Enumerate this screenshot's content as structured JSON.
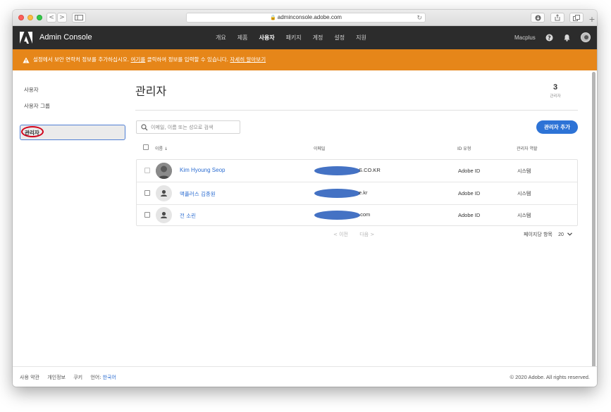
{
  "browser": {
    "url": "adminconsole.adobe.com",
    "back_label": "<",
    "forward_label": ">",
    "new_tab_label": "+"
  },
  "header": {
    "title": "Admin Console",
    "nav": [
      "개요",
      "제품",
      "사용자",
      "패키지",
      "계정",
      "설정",
      "지원"
    ],
    "active_nav": "사용자",
    "org_name": "Macplus",
    "icons": [
      "help-icon",
      "bell-icon",
      "avatar"
    ]
  },
  "banner": {
    "text_before": "설정에서 보안 연락처 정보를 추가하십시오. ",
    "link_here": "여기를",
    "text_after": " 클릭하여 정보를 입력할 수 있습니다. ",
    "learn_more": "자세히 알아보기",
    "color": "#e68619"
  },
  "sidebar": {
    "items": [
      "사용자",
      "사용자 그룹",
      "관리자"
    ],
    "selected": "관리자"
  },
  "main": {
    "title": "관리자",
    "count": "3",
    "count_label": "관리자",
    "search_placeholder": "이메일, 이름 또는 성으로 검색",
    "add_button": "관리자 추가",
    "accent": "#2d73d6"
  },
  "table": {
    "headers": {
      "name": "이름",
      "sort_icon": "↓",
      "email": "이메일",
      "id_type": "ID 유형",
      "role": "관리자 역할"
    },
    "rows": [
      {
        "name": "Kim Hyoung Seop",
        "email_visible": "S.CO.KR",
        "id_type": "Adobe ID",
        "role": "시스템"
      },
      {
        "name": "맥플러스 김종원",
        "email_visible": "e.kr",
        "id_type": "Adobe ID",
        "role": "시스템"
      },
      {
        "name": "전 소린",
        "email_visible": ".com",
        "id_type": "Adobe ID",
        "role": "시스템"
      }
    ]
  },
  "pagination": {
    "prev": "< 이전",
    "next": "다음 >",
    "per_page_label": "페이지당 항목",
    "per_page_value": "20"
  },
  "footer": {
    "terms": "사용 약관",
    "privacy": "개인정보",
    "cookies": "쿠키",
    "language_label": "언어:",
    "language_value": "한국어",
    "copyright": "© 2020 Adobe. All rights reserved."
  }
}
